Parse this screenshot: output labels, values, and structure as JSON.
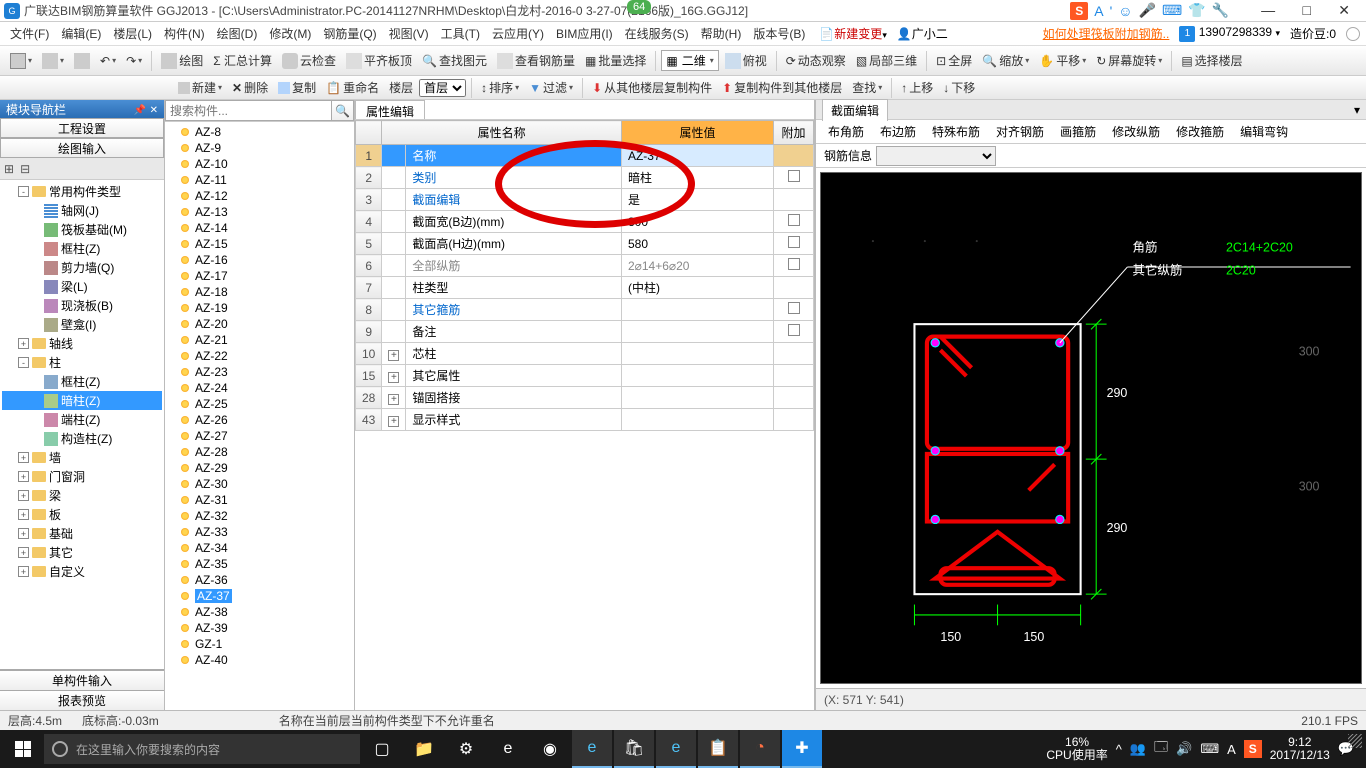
{
  "title": "广联达BIM钢筋算量软件 GGJ2013 - [C:\\Users\\Administrator.PC-20141127NRHM\\Desktop\\白龙村-2016-0    3-27-07(2166版)_16G.GGJ12]",
  "badge64": "64",
  "win_controls": {
    "min": "—",
    "max": "□",
    "close": "✕"
  },
  "menubar": {
    "items": [
      "文件(F)",
      "编辑(E)",
      "楼层(L)",
      "构件(N)",
      "绘图(D)",
      "修改(M)",
      "钢筋量(Q)",
      "视图(V)",
      "工具(T)",
      "云应用(Y)",
      "BIM应用(I)",
      "在线服务(S)",
      "帮助(H)",
      "版本号(B)"
    ],
    "newchange": "新建变更",
    "user_icon_label": "广小二",
    "link": "如何处理筏板附加钢筋..",
    "phone": "13907298339",
    "beans": "造价豆:0"
  },
  "toolbar1": {
    "items": [
      "绘图",
      "Σ 汇总计算",
      "云检查",
      "平齐板顶",
      "查找图元",
      "查看钢筋量",
      "批量选择"
    ],
    "view_dd": "二维",
    "items2": [
      "俯视",
      "动态观察",
      "局部三维",
      "全屏",
      "缩放",
      "平移",
      "屏幕旋转",
      "选择楼层"
    ]
  },
  "nav": {
    "header": "模块导航栏",
    "btn1": "工程设置",
    "btn2": "绘图输入",
    "tree": [
      {
        "exp": "-",
        "fold": true,
        "label": "常用构件类型",
        "lvl": 0
      },
      {
        "tico": "tico-grid",
        "label": "轴网(J)",
        "lvl": 1
      },
      {
        "tico": "tico-raft",
        "label": "筏板基础(M)",
        "lvl": 1
      },
      {
        "tico": "tico-frame",
        "label": "框柱(Z)",
        "lvl": 1
      },
      {
        "tico": "tico-shear",
        "label": "剪力墙(Q)",
        "lvl": 1
      },
      {
        "tico": "tico-beam",
        "label": "梁(L)",
        "lvl": 1
      },
      {
        "tico": "tico-slab",
        "label": "现浇板(B)",
        "lvl": 1
      },
      {
        "tico": "tico-wall",
        "label": "壁龛(I)",
        "lvl": 1
      },
      {
        "exp": "+",
        "fold": true,
        "label": "轴线",
        "lvl": 0
      },
      {
        "exp": "-",
        "fold": true,
        "label": "柱",
        "lvl": 0
      },
      {
        "tico": "tico-col1",
        "label": "框柱(Z)",
        "lvl": 1
      },
      {
        "tico": "tico-col2",
        "label": "暗柱(Z)",
        "lvl": 1,
        "sel": true
      },
      {
        "tico": "tico-col3",
        "label": "端柱(Z)",
        "lvl": 1
      },
      {
        "tico": "tico-col4",
        "label": "构造柱(Z)",
        "lvl": 1
      },
      {
        "exp": "+",
        "fold": true,
        "label": "墙",
        "lvl": 0
      },
      {
        "exp": "+",
        "fold": true,
        "label": "门窗洞",
        "lvl": 0
      },
      {
        "exp": "+",
        "fold": true,
        "label": "梁",
        "lvl": 0
      },
      {
        "exp": "+",
        "fold": true,
        "label": "板",
        "lvl": 0
      },
      {
        "exp": "+",
        "fold": true,
        "label": "基础",
        "lvl": 0
      },
      {
        "exp": "+",
        "fold": true,
        "label": "其它",
        "lvl": 0
      },
      {
        "exp": "+",
        "fold": true,
        "label": "自定义",
        "lvl": 0
      }
    ],
    "btn3": "单构件输入",
    "btn4": "报表预览"
  },
  "comp": {
    "toolbar": {
      "new": "新建",
      "del": "删除",
      "copy": "复制",
      "rename": "重命名",
      "floor": "楼层",
      "first": "首层"
    },
    "search_placeholder": "搜索构件...",
    "list": [
      "AZ-8",
      "AZ-9",
      "AZ-10",
      "AZ-11",
      "AZ-12",
      "AZ-13",
      "AZ-14",
      "AZ-15",
      "AZ-16",
      "AZ-17",
      "AZ-18",
      "AZ-19",
      "AZ-20",
      "AZ-21",
      "AZ-22",
      "AZ-23",
      "AZ-24",
      "AZ-25",
      "AZ-26",
      "AZ-27",
      "AZ-28",
      "AZ-29",
      "AZ-30",
      "AZ-31",
      "AZ-32",
      "AZ-33",
      "AZ-34",
      "AZ-35",
      "AZ-36",
      "AZ-37",
      "AZ-38",
      "AZ-39",
      "GZ-1",
      "AZ-40"
    ],
    "selected": "AZ-37"
  },
  "center_toolbar": {
    "sort": "排序",
    "filter": "过滤",
    "copy_from": "从其他楼层复制构件",
    "copy_to": "复制构件到其他楼层",
    "search": "查找",
    "up": "上移",
    "down": "下移"
  },
  "prop": {
    "tab": "属性编辑",
    "headers": {
      "name": "属性名称",
      "value": "属性值",
      "attach": "附加"
    },
    "rows": [
      {
        "n": "1",
        "name": "名称",
        "val": "AZ-37",
        "chk": "",
        "sel": true
      },
      {
        "n": "2",
        "name": "类别",
        "val": "暗柱",
        "chk": true,
        "blue": true
      },
      {
        "n": "3",
        "name": "截面编辑",
        "val": "是",
        "blue": true
      },
      {
        "n": "4",
        "name": "截面宽(B边)(mm)",
        "val": "300",
        "chk": true
      },
      {
        "n": "5",
        "name": "截面高(H边)(mm)",
        "val": "580",
        "chk": true
      },
      {
        "n": "6",
        "name": "全部纵筋",
        "val": "2⌀14+6⌀20",
        "chk": true,
        "gray": true
      },
      {
        "n": "7",
        "name": "柱类型",
        "val": "(中柱)"
      },
      {
        "n": "8",
        "name": "其它箍筋",
        "val": "",
        "chk": true,
        "blue": true
      },
      {
        "n": "9",
        "name": "备注",
        "val": "",
        "chk": true
      },
      {
        "n": "10",
        "name": "芯柱",
        "exp": "+"
      },
      {
        "n": "15",
        "name": "其它属性",
        "exp": "+"
      },
      {
        "n": "28",
        "name": "锚固搭接",
        "exp": "+"
      },
      {
        "n": "43",
        "name": "显示样式",
        "exp": "+"
      }
    ]
  },
  "section": {
    "tab": "截面编辑",
    "tabs2": [
      "布角筋",
      "布边筋",
      "特殊布筋",
      "对齐钢筋",
      "画箍筋",
      "修改纵筋",
      "修改箍筋",
      "编辑弯钩"
    ],
    "info_label": "钢筋信息",
    "labels": {
      "corner": "角筋",
      "other": "其它纵筋",
      "val1": "2C14+2C20",
      "val2": "2C20"
    },
    "dims": {
      "h1": "290",
      "h2": "290",
      "w1": "150",
      "w2": "150",
      "side1": "300",
      "side2": "300"
    },
    "status": "(X: 571 Y: 541)"
  },
  "statusbar": {
    "floor_h": "层高:4.5m",
    "bottom_h": "底标高:-0.03m",
    "msg": "名称在当前层当前构件类型下不允许重名",
    "fps": "210.1 FPS"
  },
  "taskbar": {
    "search": "在这里输入你要搜索的内容",
    "cpu": {
      "pct": "16%",
      "label": "CPU使用率"
    },
    "clock": {
      "time": "9:12",
      "date": "2017/12/13"
    }
  }
}
